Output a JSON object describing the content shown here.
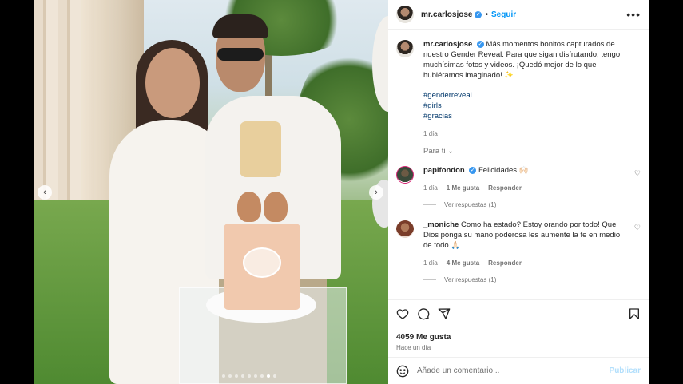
{
  "post": {
    "username": "mr.carlosjose",
    "follow_label": "Seguir",
    "header_separator": "•",
    "more_label": "•••",
    "caption": "Más momentos bonitos capturados de nuestro Gender Reveal. Para que sigan disfrutando, tengo muchísimas fotos y videos. ¡Quedó mejor de lo que hubiéramos imaginado! ✨",
    "hashtags": [
      "#genderreveal",
      "#girls",
      "#gracias"
    ],
    "caption_time": "1 día",
    "for_you_label": "Para ti",
    "likes_label": "4059 Me gusta",
    "posted_ago": "Hace un día",
    "carousel_total": 9,
    "carousel_active": 8
  },
  "comments": [
    {
      "username": "papifondon",
      "verified": true,
      "text": "Felicidades 🙌🏻",
      "time": "1 día",
      "likes": "1 Me gusta",
      "reply_label": "Responder",
      "view_replies": "Ver respuestas (1)"
    },
    {
      "username": "_moniche",
      "verified": false,
      "text": "Como ha estado? Estoy orando por todo! Que Dios ponga su mano poderosa les aumente la fe en medio de todo 🙏🏻",
      "time": "1 día",
      "likes": "4 Me gusta",
      "reply_label": "Responder",
      "view_replies": "Ver respuestas (1)"
    }
  ],
  "composer": {
    "placeholder": "Añade un comentario...",
    "publish_label": "Publicar"
  },
  "icons": {
    "nav_prev": "‹",
    "nav_next": "›",
    "chevron": "⌄",
    "heart_small": "♡",
    "verified_check": "✓"
  },
  "colors": {
    "accent": "#0095f6",
    "verified": "#3797f0",
    "hashtag": "#00376b",
    "secondary_text": "#737373",
    "publish_disabled": "#b2dffc"
  }
}
